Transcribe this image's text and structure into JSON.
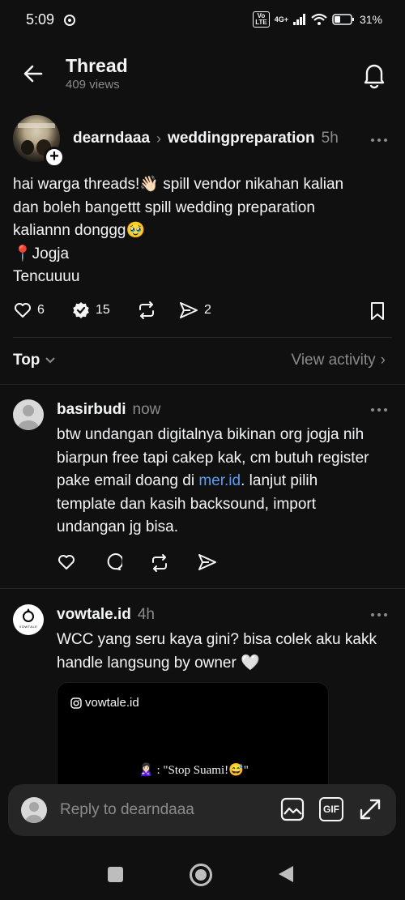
{
  "status_bar": {
    "time": "5:09",
    "volte": "Vo\nLTE",
    "network": "4G+",
    "battery": "31%"
  },
  "header": {
    "title": "Thread",
    "views": "409 views"
  },
  "post": {
    "username": "dearndaaa",
    "chevron": "›",
    "topic": "weddingpreparation",
    "time": "5h",
    "lines": [
      "hai warga threads!👋🏻 spill vendor nikahan kalian",
      "dan boleh bangettt spill wedding preparation",
      "kaliannn donggg🥹",
      "📍Jogja",
      "Tencuuuu"
    ],
    "likes": "6",
    "reposts": "15",
    "shares": "2"
  },
  "sort": {
    "label": "Top",
    "chevron": "⌄",
    "view_activity": "View activity",
    "view_chevron": "›"
  },
  "replies": [
    {
      "username": "basirbudi",
      "time": "now",
      "lines": [
        [
          "btw undangan digitalnya bikinan org jogja nih"
        ],
        [
          "biarpun free tapi cakep kak, cm butuh register"
        ],
        [
          "pake email doang di ",
          "mer.id",
          ". lanjut pilih"
        ],
        [
          "template dan kasih backsound, import"
        ],
        [
          "undangan jg bisa."
        ]
      ]
    },
    {
      "username": "vowtale.id",
      "time": "4h",
      "avatar_label": "VOWTALE",
      "lines": [
        "WCC yang seru kaya gini? bisa colek aku kakk",
        "handle langsung by owner 🤍"
      ],
      "media": {
        "handle": "vowtale.id",
        "caption": "🙎🏻‍♀️ : \"Stop Suami!😅\""
      }
    }
  ],
  "composer": {
    "placeholder": "Reply to dearndaaa",
    "gif_label": "GIF"
  },
  "colors": {
    "background": "#101010",
    "text": "#f3f5f7",
    "muted": "#8b8b8b",
    "link": "#5b9cf6"
  }
}
